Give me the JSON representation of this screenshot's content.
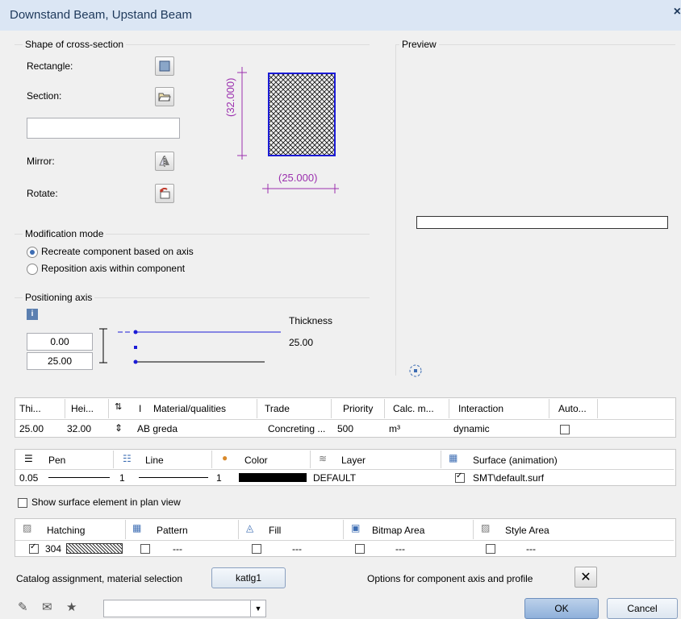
{
  "window": {
    "title": "Downstand Beam, Upstand Beam",
    "close": "×"
  },
  "shape": {
    "legend": "Shape of cross-section",
    "rectangle_label": "Rectangle:",
    "section_label": "Section:",
    "section_value": "",
    "mirror_label": "Mirror:",
    "rotate_label": "Rotate:",
    "dim_height": "(32.000)",
    "dim_width": "(25.000)"
  },
  "preview": {
    "legend": "Preview"
  },
  "modification": {
    "legend": "Modification mode",
    "options": [
      "Recreate component based on axis",
      "Reposition axis within component"
    ],
    "selected": 0
  },
  "positioning": {
    "legend": "Positioning axis",
    "top_value": "0.00",
    "bottom_value": "25.00",
    "thickness_label": "Thickness",
    "thickness_value": "25.00"
  },
  "props_table": {
    "headers": [
      "Thi...",
      "Hei...",
      "I",
      "Material/qualities",
      "Trade",
      "Priority",
      "Calc. m...",
      "Interaction",
      "Auto..."
    ],
    "row": [
      "25.00",
      "32.00",
      "AB greda",
      "Concreting ...",
      "500",
      "m³",
      "dynamic"
    ]
  },
  "format_table": {
    "headers": [
      "Pen",
      "Line",
      "Color",
      "Layer",
      "Surface (animation)"
    ],
    "pen": "0.05",
    "line": "1",
    "color": "1",
    "layer": "DEFAULT",
    "surface": "SMT\\default.surf"
  },
  "show_surface": "Show surface element in plan view",
  "fill_table": {
    "headers": [
      "Hatching",
      "Pattern",
      "Fill",
      "Bitmap Area",
      "Style Area"
    ],
    "hatching_value": "304",
    "empty": "---"
  },
  "catalog": {
    "label": "Catalog assignment, material selection",
    "button": "katlg1"
  },
  "options_label": "Options for component axis and profile",
  "buttons": {
    "ok": "OK",
    "cancel": "Cancel"
  },
  "colors": {
    "accent": "#3d6db3",
    "dimension": "#9b2fae",
    "hatch": "#1b1bd6"
  }
}
